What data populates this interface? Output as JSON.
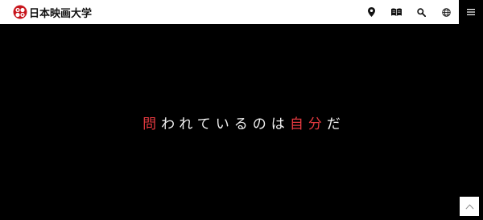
{
  "header": {
    "logo_text": "日本映画大学",
    "tools": [
      {
        "icon": "map-pin-icon"
      },
      {
        "icon": "book-icon"
      },
      {
        "icon": "search-icon"
      },
      {
        "icon": "globe-icon"
      }
    ],
    "menu_icon": "hamburger-menu-icon"
  },
  "hero": {
    "catchphrase": [
      {
        "text": "問",
        "accent": true
      },
      {
        "text": "われているのは",
        "accent": false
      },
      {
        "text": "自",
        "accent": true
      },
      {
        "text": "分",
        "accent": true
      },
      {
        "text": "だ",
        "accent": false
      }
    ]
  },
  "pagetop": {
    "icon": "chevron-up-icon"
  },
  "colors": {
    "accent": "#e3393f",
    "header_bg": "#ffffff",
    "hero_bg": "#000000",
    "text_light": "#f2f2f2"
  }
}
